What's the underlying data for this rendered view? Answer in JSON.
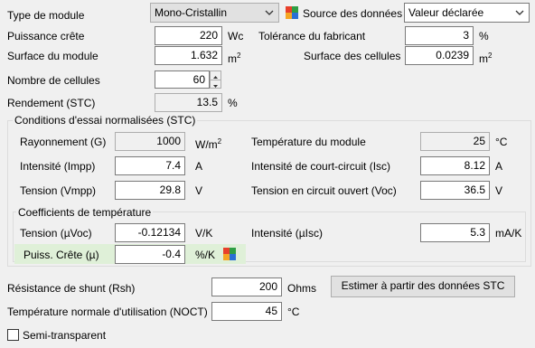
{
  "module": {
    "type_label": "Type de module",
    "type_value": "Mono-Cristallin",
    "source_label": "Source des données",
    "source_value": "Valeur déclarée",
    "power_label": "Puissance crête",
    "power_value": "220",
    "power_unit": "Wc",
    "tolerance_label": "Tolérance du fabricant",
    "tolerance_value": "3",
    "tolerance_unit": "%",
    "area_label": "Surface du module",
    "area_value": "1.632",
    "area_unit_base": "m",
    "area_unit_exp": "2",
    "cell_area_label": "Surface des cellules",
    "cell_area_value": "0.0239",
    "cell_area_unit_base": "m",
    "cell_area_unit_exp": "2",
    "cells_label": "Nombre de cellules",
    "cells_value": "60",
    "efficiency_label": "Rendement (STC)",
    "efficiency_value": "13.5",
    "efficiency_unit": "%"
  },
  "stc": {
    "title": "Conditions d'essai normalisées (STC)",
    "irradiance_label": "Rayonnement (G)",
    "irradiance_value": "1000",
    "irradiance_unit_base": "W/m",
    "irradiance_unit_exp": "2",
    "temp_label": "Température du module",
    "temp_value": "25",
    "temp_unit": "°C",
    "impp_label": "Intensité (Impp)",
    "impp_value": "7.4",
    "impp_unit": "A",
    "isc_label": "Intensité de court-circuit (Isc)",
    "isc_value": "8.12",
    "isc_unit": "A",
    "vmpp_label": "Tension (Vmpp)",
    "vmpp_value": "29.8",
    "vmpp_unit": "V",
    "voc_label": "Tension en circuit ouvert (Voc)",
    "voc_value": "36.5",
    "voc_unit": "V"
  },
  "temp_coeffs": {
    "title": "Coefficients de température",
    "uvoc_label": "Tension (µVoc)",
    "uvoc_value": "-0.12134",
    "uvoc_unit": "V/K",
    "uisc_label": "Intensité (µIsc)",
    "uisc_value": "5.3",
    "uisc_unit": "mA/K",
    "upower_label": "Puiss. Crête (µ)",
    "upower_value": "-0.4",
    "upower_unit": "%/K"
  },
  "shunt": {
    "label": "Résistance de shunt (Rsh)",
    "value": "200",
    "unit": "Ohms",
    "estimate_button": "Estimer à partir des données STC"
  },
  "noct": {
    "label": "Température normale d'utilisation (NOCT)",
    "value": "45",
    "unit": "°C"
  },
  "semi_transparent": {
    "label": "Semi-transparent",
    "checked": false
  },
  "icons": {
    "mosaic": "color-grid-icon",
    "dropdown": "chevron-down-icon"
  },
  "colors": {
    "mosaic": [
      "#e8402a",
      "#2f9e44",
      "#f5a623",
      "#2a6fd6"
    ],
    "highlight": "#dff0d8"
  }
}
